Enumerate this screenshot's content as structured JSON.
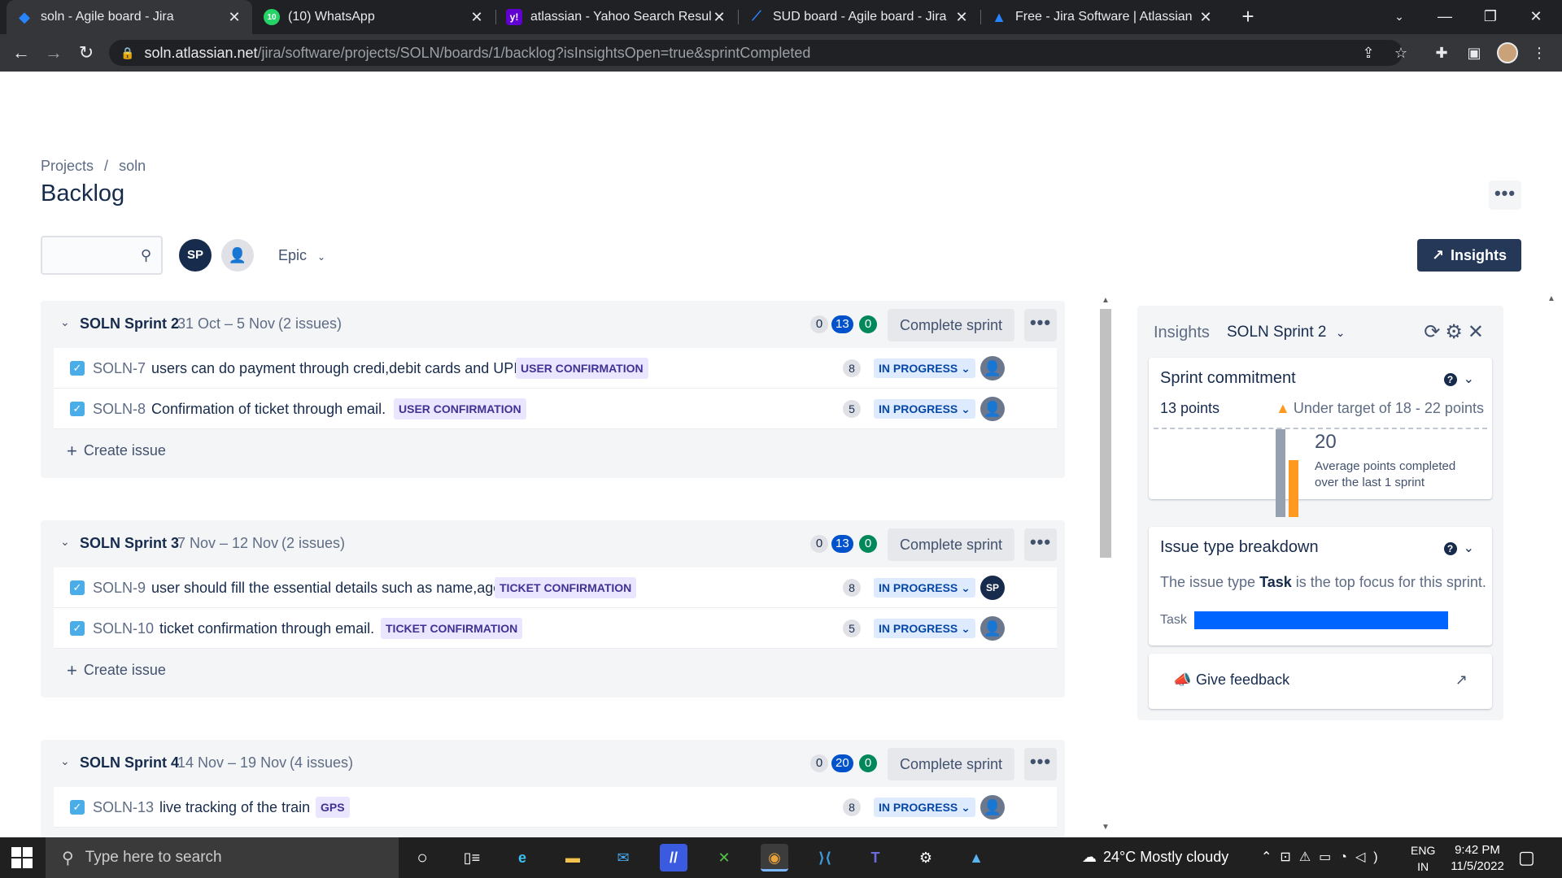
{
  "browser": {
    "tabs": [
      {
        "title": "soln - Agile board - Jira",
        "active": true,
        "icon": "jira-icon"
      },
      {
        "title": "(10) WhatsApp",
        "active": false,
        "icon": "whatsapp-icon",
        "badge": "10"
      },
      {
        "title": "atlassian - Yahoo Search Results",
        "active": false,
        "icon": "yahoo-icon"
      },
      {
        "title": "SUD board - Agile board - Jira",
        "active": false,
        "icon": "jira-icon"
      },
      {
        "title": "Free - Jira Software | Atlassian",
        "active": false,
        "icon": "atlassian-icon"
      }
    ],
    "url_host": "soln.atlassian.net",
    "url_path": "/jira/software/projects/SOLN/boards/1/backlog?isInsightsOpen=true&sprintCompleted"
  },
  "breadcrumb": {
    "projects": "Projects",
    "separator": "/",
    "project": "soln"
  },
  "page_title": "Backlog",
  "toolbar": {
    "avatar_initials": "SP",
    "epic_filter": "Epic",
    "insights_label": "Insights"
  },
  "sprints": [
    {
      "name": "SOLN Sprint 2",
      "dates": "31 Oct – 5 Nov",
      "count": "(2 issues)",
      "todo": "0",
      "inprogress": "13",
      "done": "0",
      "complete_label": "Complete sprint",
      "issues": [
        {
          "key": "SOLN-7",
          "summary": "users can do payment through credi,debit cards and UPI.",
          "epic": "USER CONFIRMATION",
          "points": "8",
          "status": "IN PROGRESS",
          "assignee": ""
        },
        {
          "key": "SOLN-8",
          "summary": "Confirmation of ticket through email.",
          "epic": "USER CONFIRMATION",
          "points": "5",
          "status": "IN PROGRESS",
          "assignee": ""
        }
      ],
      "create_label": "Create issue"
    },
    {
      "name": "SOLN Sprint 3",
      "dates": "7 Nov – 12 Nov",
      "count": "(2 issues)",
      "todo": "0",
      "inprogress": "13",
      "done": "0",
      "complete_label": "Complete sprint",
      "issues": [
        {
          "key": "SOLN-9",
          "summary": "user should fill the essential details such as name,age.",
          "epic": "TICKET CONFIRMATION",
          "points": "8",
          "status": "IN PROGRESS",
          "assignee": "SP"
        },
        {
          "key": "SOLN-10",
          "summary": "ticket confirmation through email.",
          "epic": "TICKET CONFIRMATION",
          "points": "5",
          "status": "IN PROGRESS",
          "assignee": ""
        }
      ],
      "create_label": "Create issue"
    },
    {
      "name": "SOLN Sprint 4",
      "dates": "14 Nov – 19 Nov",
      "count": "(4 issues)",
      "todo": "0",
      "inprogress": "20",
      "done": "0",
      "complete_label": "Complete sprint",
      "issues": [
        {
          "key": "SOLN-13",
          "summary": "live tracking of the train",
          "epic": "GPS",
          "points": "8",
          "status": "IN PROGRESS",
          "assignee": ""
        }
      ]
    }
  ],
  "insights": {
    "title": "Insights",
    "sprint_select": "SOLN Sprint 2",
    "commitment": {
      "title": "Sprint commitment",
      "points": "13 points",
      "warning": "Under target of 18 - 22 points",
      "average": "20",
      "average_desc": "Average points completed over the last 1 sprint"
    },
    "breakdown": {
      "title": "Issue type breakdown",
      "desc_prefix": "The issue type ",
      "desc_type": "Task",
      "desc_suffix": " is the top focus for this sprint.",
      "bar_label": "Task"
    },
    "feedback": "Give feedback"
  },
  "taskbar": {
    "search_placeholder": "Type here to search",
    "weather": "24°C  Mostly cloudy",
    "lang_line1": "ENG",
    "lang_line2": "IN",
    "time": "9:42 PM",
    "date": "11/5/2022"
  }
}
